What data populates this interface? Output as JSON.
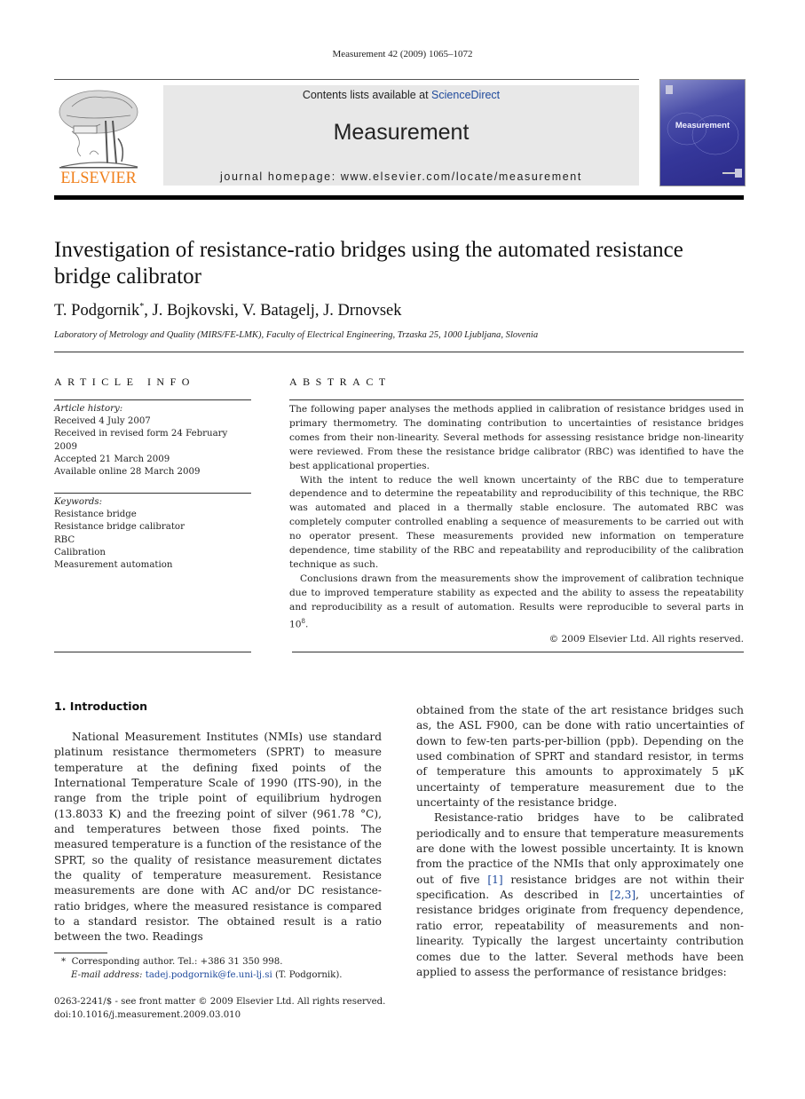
{
  "running_head": "Measurement 42 (2009) 1065–1072",
  "masthead": {
    "publisher_logo_text": "ELSEVIER",
    "contents_prefix": "Contents lists available at ",
    "contents_link": "ScienceDirect",
    "journal_name": "Measurement",
    "homepage": "journal homepage: www.elsevier.com/locate/measurement",
    "cover_title": "Measurement"
  },
  "colors": {
    "elsevier_orange": "#f07f1a",
    "link_blue": "#1f4a9c",
    "masthead_gray": "#e8e8e8",
    "cover_purple": "#35379a"
  },
  "article": {
    "title": "Investigation of resistance-ratio bridges using the automated resistance bridge calibrator",
    "authors": [
      {
        "name": "T. Podgornik",
        "mark": "*",
        "sep": ", "
      },
      {
        "name": "J. Bojkovski",
        "mark": "",
        "sep": ", "
      },
      {
        "name": "V. Batagelj",
        "mark": "",
        "sep": ", "
      },
      {
        "name": "J. Drnovsek",
        "mark": "",
        "sep": ""
      }
    ],
    "affiliation": "Laboratory of Metrology and Quality (MIRS/FE-LMK), Faculty of Electrical Engineering, Trzaska 25, 1000 Ljubljana, Slovenia"
  },
  "article_info": {
    "label": "ARTICLE INFO",
    "history_label": "Article history:",
    "history": [
      "Received 4 July 2007",
      "Received in revised form 24 February 2009",
      "Accepted 21 March 2009",
      "Available online 28 March 2009"
    ],
    "keywords_label": "Keywords:",
    "keywords": [
      "Resistance bridge",
      "Resistance bridge calibrator",
      "RBC",
      "Calibration",
      "Measurement automation"
    ]
  },
  "abstract": {
    "label": "ABSTRACT",
    "paragraphs": [
      "The following paper analyses the methods applied in calibration of resistance bridges used in primary thermometry. The dominating contribution to uncertainties of resistance bridges comes from their non-linearity. Several methods for assessing resistance bridge non-linearity were reviewed. From these the resistance bridge calibrator (RBC) was identified to have the best applicational properties.",
      "With the intent to reduce the well known uncertainty of the RBC due to temperature dependence and to determine the repeatability and reproducibility of this technique, the RBC was automated and placed in a thermally stable enclosure. The automated RBC was completely computer controlled enabling a sequence of measurements to be carried out with no operator present. These measurements provided new information on temperature dependence, time stability of the RBC and repeatability and reproducibility of the calibration technique as such.",
      "Conclusions drawn from the measurements show the improvement of calibration technique due to improved temperature stability as expected and the ability to assess the repeatability and reproducibility as a result of automation. Results were reproducible to several parts in 10"
    ],
    "exponent": "8",
    "end_punct": ".",
    "copyright": "© 2009 Elsevier Ltd. All rights reserved."
  },
  "body": {
    "section_heading": "1.  Introduction",
    "left_column": "National Measurement Institutes (NMIs) use standard platinum resistance thermometers (SPRT) to measure temperature at the defining fixed points of the International Temperature Scale of 1990 (ITS-90), in the range from the triple point of equilibrium hydrogen (13.8033 K) and the freezing point of silver (961.78 °C), and temperatures between those fixed points. The measured temperature is a function of the resistance of the SPRT, so the quality of resistance measurement dictates the quality of temperature measurement. Resistance measurements are done with AC and/or DC resistance-ratio bridges, where the measured resistance is compared to a standard resistor. The obtained result is a ratio between the two. Readings",
    "right_column_p1": "obtained from the state of the art resistance bridges such as, the ASL F900, can be done with ratio uncertainties of down to few-ten parts-per-billion (ppb). Depending on the used combination of SPRT and standard resistor, in terms of temperature this amounts to approximately 5 μK uncertainty of temperature measurement due to the uncertainty of the resistance bridge.",
    "right_column_p2": {
      "part1": "Resistance-ratio bridges have to be calibrated periodically and to ensure that temperature measurements are done with the lowest possible uncertainty. It is known from the practice of the NMIs that only approximately one out of five ",
      "ref1": "[1]",
      "part2": " resistance bridges are not within their specification. As described in ",
      "ref2": "[2,3]",
      "part3": ", uncertainties of resistance bridges originate from frequency dependence, ratio error, repeatability of measurements and non-linearity. Typically the largest uncertainty contribution comes due to the latter. Several methods have been applied to assess the performance of resistance bridges:"
    }
  },
  "footnote": {
    "mark": "*",
    "text": "Corresponding author. Tel.: +386 31 350 998.",
    "email_label": "E-mail address:",
    "email": "tadej.podgornik@fe.uni-lj.si",
    "email_suffix": " (T. Podgornik)."
  },
  "front_matter": {
    "issn_line": "0263-2241/$ - see front matter © 2009 Elsevier Ltd. All rights reserved.",
    "doi": "doi:10.1016/j.measurement.2009.03.010"
  }
}
